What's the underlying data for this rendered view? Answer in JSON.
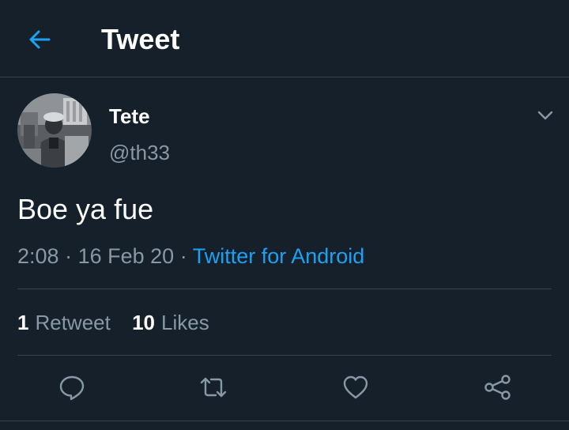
{
  "header": {
    "title": "Tweet",
    "back_icon": "arrow-left-icon"
  },
  "author": {
    "display_name": "Tete",
    "handle": "@th33",
    "avatar": "profile-photo"
  },
  "tweet": {
    "text": "Boe ya fue",
    "time": "2:08",
    "separator": "·",
    "date": "16 Feb 20",
    "source": "Twitter for Android"
  },
  "stats": {
    "retweets_count": "1",
    "retweets_label": "Retweet",
    "likes_count": "10",
    "likes_label": "Likes"
  },
  "actions": {
    "reply_icon": "reply-icon",
    "retweet_icon": "retweet-icon",
    "like_icon": "heart-icon",
    "share_icon": "share-icon"
  },
  "colors": {
    "background": "#15202b",
    "accent": "#1da1f2",
    "secondary_text": "#8899a6",
    "divider": "#38444d",
    "primary_text": "#ffffff"
  }
}
